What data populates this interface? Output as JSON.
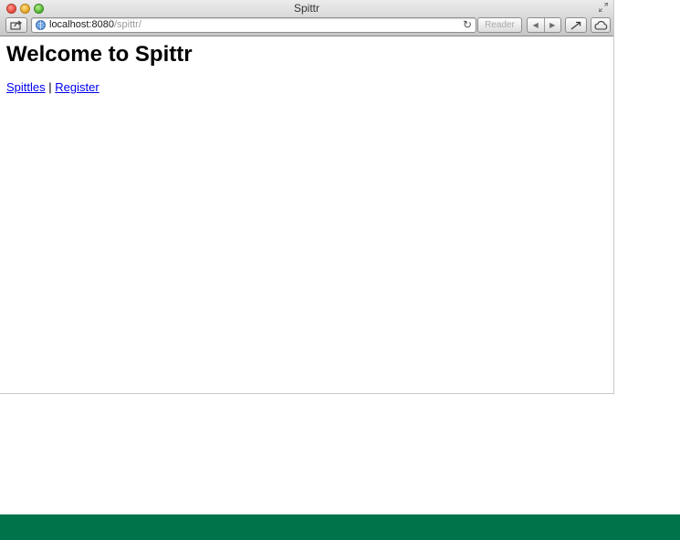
{
  "window": {
    "title": "Spittr"
  },
  "toolbar": {
    "address_host": "localhost:8080",
    "address_path": "/spittr/",
    "reader_label": "Reader",
    "icons": {
      "share": "share-icon",
      "globe": "globe-icon",
      "reload": "reload-icon",
      "back": "back-arrow-icon",
      "forward": "forward-arrow-icon",
      "action": "action-arrow-icon",
      "icloud": "cloud-icon",
      "fullscreen": "fullscreen-icon"
    }
  },
  "page": {
    "heading": "Welcome to Spittr",
    "links": {
      "spittles": "Spittles",
      "separator": "|",
      "register": "Register"
    }
  },
  "colors": {
    "link": "#0000ee",
    "footer_band": "#00734a"
  }
}
